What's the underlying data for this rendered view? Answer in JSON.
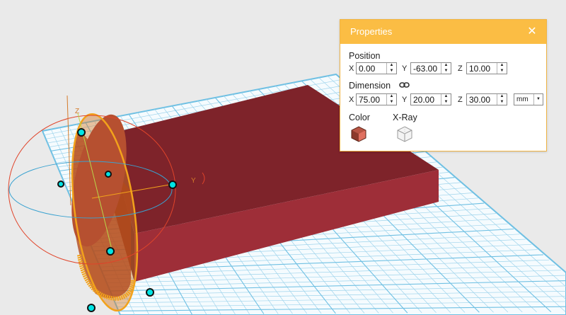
{
  "properties": {
    "title": "Properties",
    "close_glyph": "✕",
    "position": {
      "label": "Position",
      "x": {
        "axis": "X",
        "value": "0.00"
      },
      "y": {
        "axis": "Y",
        "value": "-63.00"
      },
      "z": {
        "axis": "Z",
        "value": "10.00"
      }
    },
    "dimension": {
      "label": "Dimension",
      "link_icon": "link-icon",
      "x": {
        "axis": "X",
        "value": "75.00"
      },
      "y": {
        "axis": "Y",
        "value": "20.00"
      },
      "z": {
        "axis": "Z",
        "value": "30.00"
      },
      "unit": "mm"
    },
    "color": {
      "label": "Color",
      "value": "#c0504d"
    },
    "xray": {
      "label": "X-Ray"
    }
  },
  "viewport": {
    "gizmo_labels": {
      "z": "Z",
      "y": "Y"
    },
    "colors": {
      "grid": "#6fc0e3",
      "box": "#8b2b33",
      "selection": "#f2a21b",
      "handle": "#00e5e5",
      "ring_red": "#e0442a",
      "ring_blue": "#3aa2d0"
    }
  }
}
